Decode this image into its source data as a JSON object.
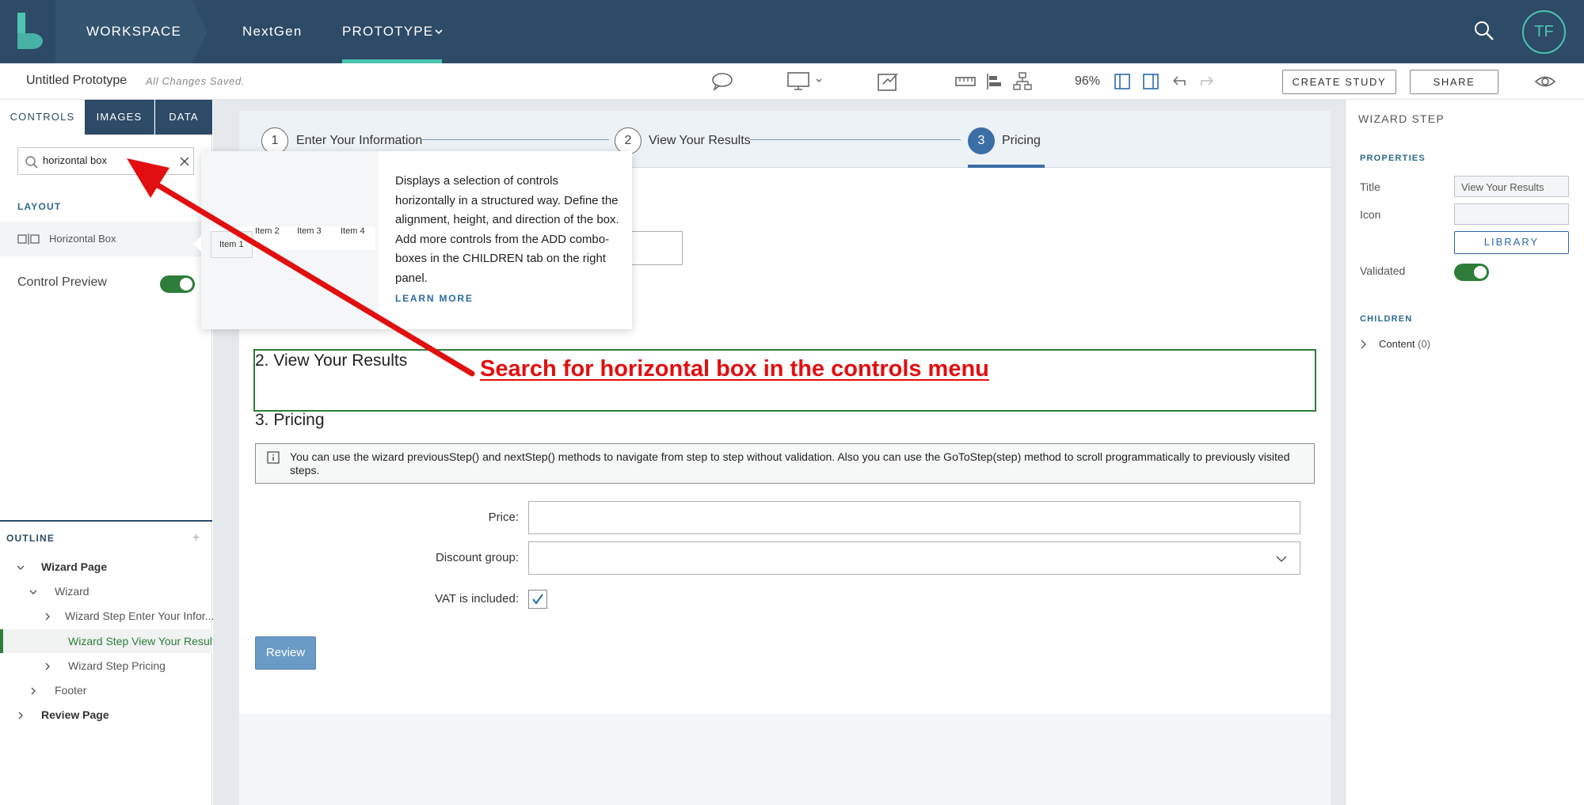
{
  "topnav": {
    "workspace": "WORKSPACE",
    "nextgen": "NextGen",
    "prototype": "PROTOTYPE",
    "avatar": "TF"
  },
  "toolbar": {
    "doc_title": "Untitled Prototype",
    "save_status": "All Changes Saved.",
    "zoom": "96%",
    "create_study": "CREATE STUDY",
    "share": "SHARE"
  },
  "left_panel": {
    "tabs": [
      {
        "label": "CONTROLS"
      },
      {
        "label": "IMAGES"
      },
      {
        "label": "DATA"
      }
    ],
    "search_value": "horizontal box",
    "layout_section": "LAYOUT",
    "control_item": "Horizontal Box",
    "control_preview_label": "Control Preview",
    "control_preview_on": true
  },
  "tooltip": {
    "preview_items": [
      "Item 1",
      "Item 2",
      "Item 3",
      "Item 4"
    ],
    "description": "Displays a selection of controls horizontally in a structured way. Define the alignment, height, and direction of the box. Add more controls from the ADD combo-boxes in the CHILDREN tab on the right panel.",
    "learn_more": "LEARN MORE"
  },
  "outline": {
    "title": "OUTLINE",
    "items": [
      {
        "label": "Wizard Page"
      },
      {
        "label": "Wizard"
      },
      {
        "label": "Wizard Step Enter Your Infor..."
      },
      {
        "label": "Wizard Step View Your Results"
      },
      {
        "label": "Wizard Step Pricing"
      },
      {
        "label": "Footer"
      },
      {
        "label": "Review Page"
      }
    ]
  },
  "wizard": {
    "steps": [
      {
        "num": "1",
        "label": "Enter Your Information"
      },
      {
        "num": "2",
        "label": "View Your Results"
      },
      {
        "num": "3",
        "label": "Pricing"
      }
    ],
    "active_step": 3,
    "section_results": "2. View Your Results",
    "section_pricing": "3. Pricing",
    "info_text": "You can use the wizard previousStep() and nextStep() methods to navigate from step to step without validation. Also you can use the GoToStep(step) method to scroll programmatically to previously visited steps.",
    "price_label": "Price:",
    "discount_label": "Discount group:",
    "vat_label": "VAT is included:",
    "vat_checked": true,
    "review_button": "Review"
  },
  "right_panel": {
    "title": "WIZARD STEP",
    "properties": "PROPERTIES",
    "title_label": "Title",
    "title_value": "View Your Results",
    "icon_label": "Icon",
    "library": "LIBRARY",
    "validated_label": "Validated",
    "validated_on": true,
    "children": "CHILDREN",
    "content_label": "Content",
    "content_count": "(0)"
  },
  "annotation": "Search for horizontal box in the controls menu",
  "colors": {
    "nav_bg": "#2d4a66",
    "accent_teal": "#4cc4b0",
    "step_active": "#3b6ea5",
    "toggle_green": "#2e7d3a",
    "annotation_red": "#e10f0f"
  }
}
